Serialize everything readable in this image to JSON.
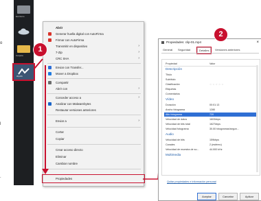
{
  "desktop": {
    "icons": [
      "Escritorio",
      "Carpeta",
      "clip-01"
    ],
    "side_texts": [
      "o",
      "l",
      "."
    ]
  },
  "menu": {
    "items": [
      {
        "label": "Abrir",
        "bold": true
      },
      {
        "label": "Generar huella digital con AutoFirma"
      },
      {
        "label": "Firmar con AutoFirma"
      },
      {
        "label": "Transmitir en dispositivo",
        "submenu": true
      },
      {
        "label": "7-Zip",
        "submenu": true
      },
      {
        "label": "CRC SHA",
        "submenu": true
      },
      {
        "label": "Enviar con Transfer..."
      },
      {
        "label": "Mover a Dropbox"
      },
      {
        "label": "Compartir"
      },
      {
        "label": "Abrir con",
        "submenu": true
      },
      {
        "label": "Conceder acceso a",
        "submenu": true
      },
      {
        "label": "Analizar con Malwarebytes"
      },
      {
        "label": "Restaurar versiones anteriores"
      },
      {
        "label": "Enviar a",
        "submenu": true
      },
      {
        "label": "Cortar"
      },
      {
        "label": "Copiar"
      },
      {
        "label": "Crear acceso directo"
      },
      {
        "label": "Eliminar"
      },
      {
        "label": "Cambiar nombre"
      },
      {
        "label": "Propiedades"
      }
    ]
  },
  "dialog": {
    "title": "Propiedades: clip-01.mp4",
    "tabs": [
      "General",
      "Seguridad",
      "Detalles",
      "Versiones anteriores"
    ],
    "active_tab": "Detalles",
    "header": {
      "k": "Propiedad",
      "v": "Valor"
    },
    "rows": [
      {
        "k": "Descripción",
        "v": "",
        "section": true
      },
      {
        "k": "Título",
        "v": ""
      },
      {
        "k": "Subtítulo",
        "v": ""
      },
      {
        "k": "Clasificación",
        "v": "☆ ☆ ☆ ☆ ☆"
      },
      {
        "k": "Etiquetas",
        "v": ""
      },
      {
        "k": "Comentarios",
        "v": ""
      },
      {
        "k": "Vídeo",
        "v": "",
        "section": true
      },
      {
        "k": "Duración",
        "v": "00:01:13"
      },
      {
        "k": "Ancho fotograma",
        "v": "1280"
      },
      {
        "k": "Alto fotograma",
        "v": "720",
        "highlight": true
      },
      {
        "k": "Velocidad de datos",
        "v": "1603kbps"
      },
      {
        "k": "Velocidad de bits total",
        "v": "1627kbps"
      },
      {
        "k": "Velocidad fotograma",
        "v": "30.00 fotogramas/segun..."
      },
      {
        "k": "Audio",
        "v": "",
        "section": true
      },
      {
        "k": "Velocidad de bits",
        "v": "159kbps"
      },
      {
        "k": "Canales",
        "v": "2 (estéreo)"
      },
      {
        "k": "Velocidad de muestra de so...",
        "v": "44.000 kHz"
      },
      {
        "k": "Multimedia",
        "v": "",
        "section": true
      }
    ],
    "link": "Quitar propiedades e información personal",
    "buttons": [
      "Aceptar",
      "Cancelar",
      "Aplicar"
    ]
  },
  "badges": [
    "1",
    "2"
  ],
  "colors": {
    "accent": "#c8102e",
    "selection": "#2f6fd4"
  }
}
